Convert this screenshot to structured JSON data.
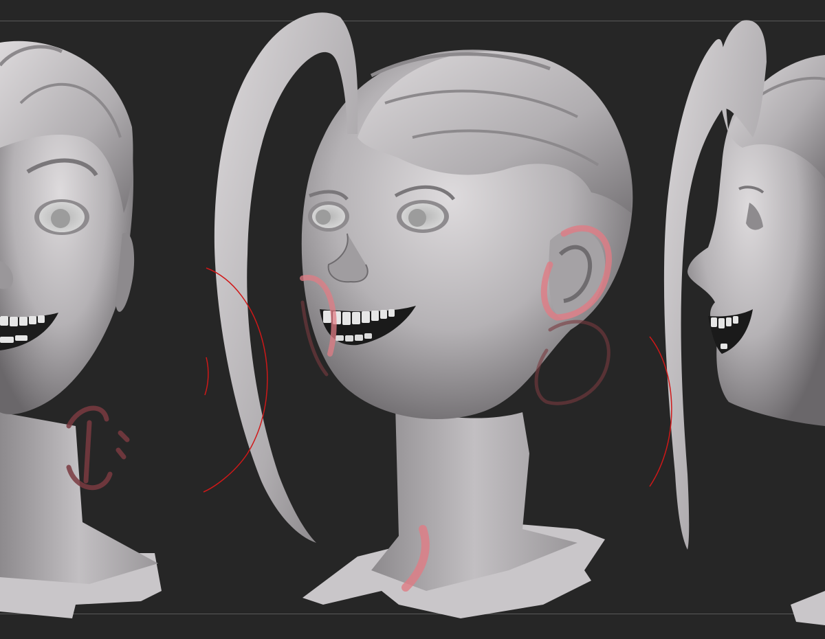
{
  "canvas": {
    "background_color": "#262626",
    "frame_line_color": "#5a5a5a"
  },
  "views": [
    {
      "name": "front-left-view"
    },
    {
      "name": "three-quarter-view"
    },
    {
      "name": "side-profile-view"
    }
  ],
  "colors": {
    "clay_light": "#d9d6d8",
    "clay_mid": "#a9a6a9",
    "clay_dark": "#6e6b6e",
    "eye_white": "#cfcfcf",
    "iris": "#9a9a9a",
    "mouth_dark": "#1a1a1a",
    "teeth": "#e6e6e6",
    "annotation_red": "#d01818",
    "annotation_pink": "#e07c84"
  }
}
